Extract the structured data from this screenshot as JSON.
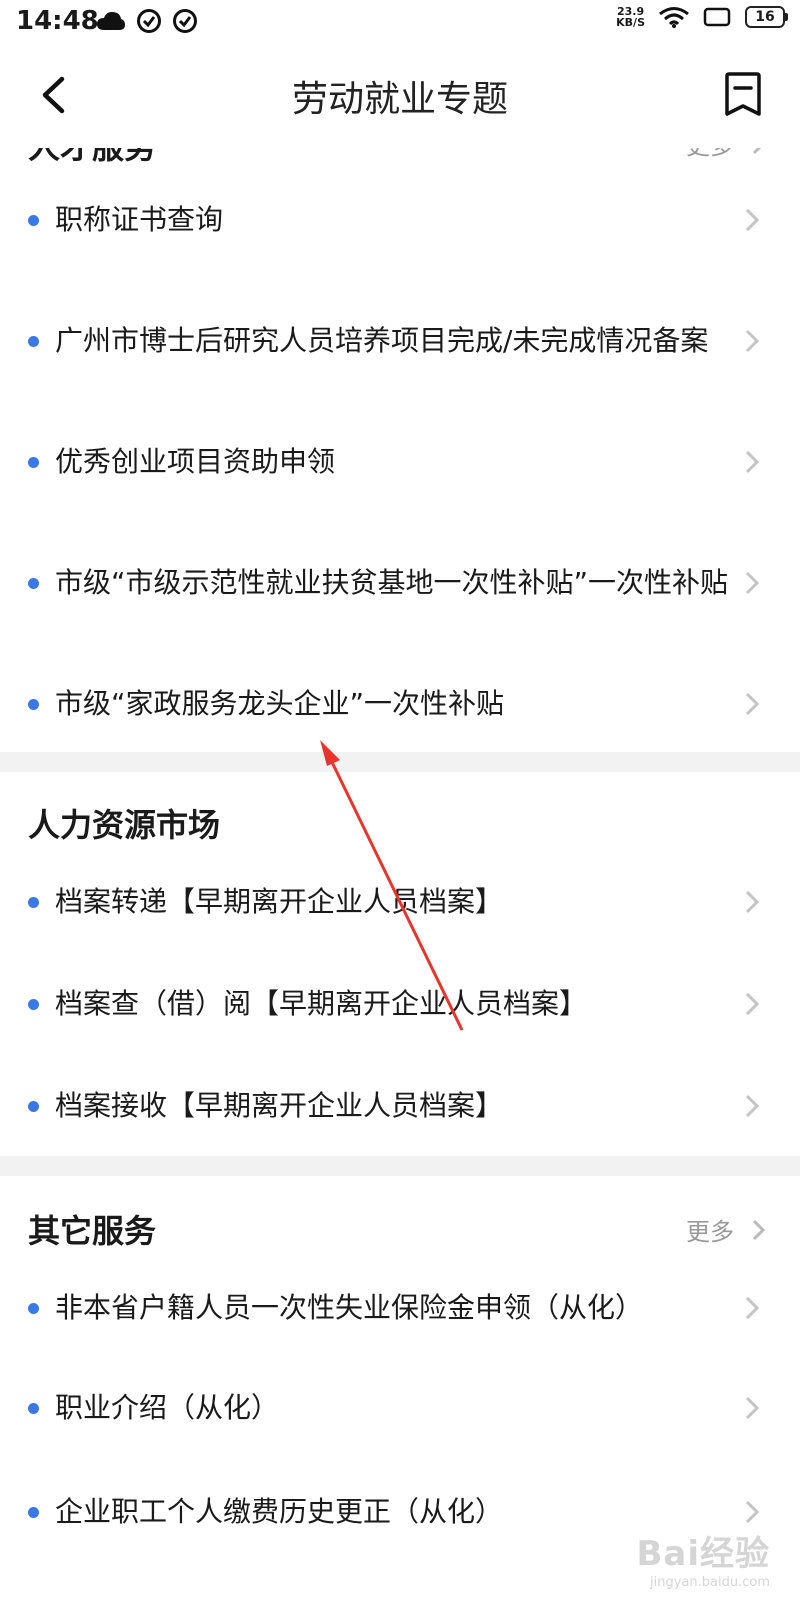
{
  "status_bar": {
    "time": "14:48",
    "net_speed_value": "23.9",
    "net_speed_unit": "KB/S",
    "battery": "16"
  },
  "nav": {
    "title": "劳动就业专题"
  },
  "sections": [
    {
      "title": "人才服务",
      "more": "更多",
      "items": [
        {
          "label": "职称证书查询"
        },
        {
          "label": "广州市博士后研究人员培养项目完成/未完成情况备案"
        },
        {
          "label": "优秀创业项目资助申领"
        },
        {
          "label": "市级“市级示范性就业扶贫基地一次性补贴”一次性补贴"
        },
        {
          "label": "市级“家政服务龙头企业”一次性补贴"
        }
      ]
    },
    {
      "title": "人力资源市场",
      "items": [
        {
          "label": "档案转递【早期离开企业人员档案】"
        },
        {
          "label": "档案查（借）阅【早期离开企业人员档案】"
        },
        {
          "label": "档案接收【早期离开企业人员档案】"
        }
      ]
    },
    {
      "title": "其它服务",
      "more": "更多",
      "items": [
        {
          "label": "非本省户籍人员一次性失业保险金申领（从化）"
        },
        {
          "label": "职业介绍（从化）"
        },
        {
          "label": "企业职工个人缴费历史更正（从化）"
        }
      ]
    }
  ],
  "watermark": {
    "main": "Bai经验",
    "sub": "jingyan.baidu.com"
  },
  "colors": {
    "accent": "#3b78e7",
    "annotation_arrow": "#e8352b",
    "divider": "#f2f2f2"
  },
  "icons": {
    "back": "chevron-left-icon",
    "bookmark": "bookmark-icon",
    "item_chevron": "chevron-right-icon"
  }
}
